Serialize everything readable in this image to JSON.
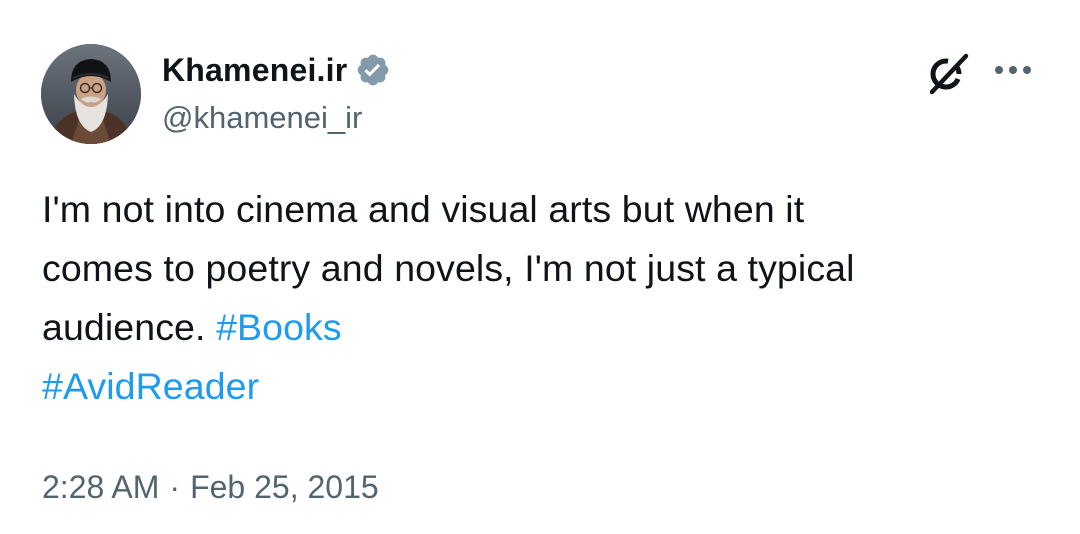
{
  "author": {
    "display_name": "Khamenei.ir",
    "handle": "@khamenei_ir",
    "verified": true,
    "verified_color": "#829aab"
  },
  "header_icons": {
    "grok": "grok-icon",
    "more": "more-options-icon"
  },
  "tweet": {
    "text_line1": "I'm not into cinema and visual arts but when it",
    "text_line2": "comes to poetry and novels, I'm not just a typical",
    "text_line3": "audience.",
    "hashtags": [
      "#Books",
      "#AvidReader"
    ],
    "hashtag_color": "#1d9bf0"
  },
  "meta": {
    "time": "2:28 AM",
    "separator": "·",
    "date": "Feb 25, 2015"
  }
}
